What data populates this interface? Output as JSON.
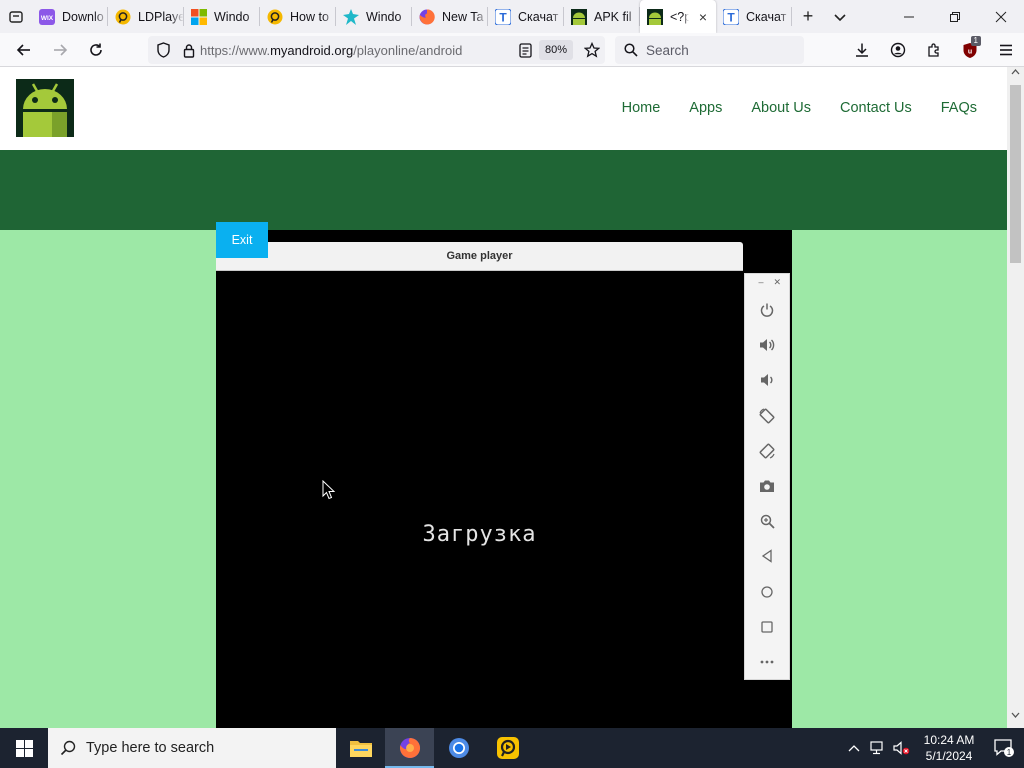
{
  "browser": {
    "tabs": [
      {
        "label": "Downlo",
        "favicon": "wix-icon",
        "color": "#8c58e8"
      },
      {
        "label": "LDPlaye",
        "favicon": "ldplayer-icon",
        "color": "#f5b800"
      },
      {
        "label": "Windo",
        "favicon": "windows-icon",
        "color": "#00a4ef"
      },
      {
        "label": "How to",
        "favicon": "ldplayer-icon",
        "color": "#f5b800"
      },
      {
        "label": "Windo",
        "favicon": "gear-icon",
        "color": "#1fb8c9"
      },
      {
        "label": "New Ta",
        "favicon": "firefox-icon",
        "color": "#ff7139"
      },
      {
        "label": "Скачат",
        "favicon": "t-icon",
        "color": "#2a6ad8"
      },
      {
        "label": "APK fil",
        "favicon": "android-icon",
        "color": "#1f6535"
      },
      {
        "label": "<?p",
        "favicon": "android-icon",
        "color": "#1f6535",
        "active": true
      },
      {
        "label": "Скачат",
        "favicon": "t-icon",
        "color": "#2a6ad8"
      }
    ],
    "url_prefix": "https://www.",
    "url_domain": "myandroid.org",
    "url_path": "/playonline/android",
    "zoom": "80%",
    "search_placeholder": "Search",
    "extension_badge": "1"
  },
  "site": {
    "nav": [
      "Home",
      "Apps",
      "About Us",
      "Contact Us",
      "FAQs"
    ],
    "exit_label": "Exit",
    "player_title": "Game player",
    "loading_text": "Загрузка",
    "side_controls": [
      "power-icon",
      "volume-up-icon",
      "volume-down-icon",
      "rotate-left-icon",
      "rotate-right-icon",
      "camera-icon",
      "zoom-icon",
      "back-icon",
      "home-icon",
      "recents-icon",
      "more-icon"
    ],
    "colors": {
      "band": "#1f6535",
      "background": "#9de8a6",
      "exit": "#0ab0f0",
      "link": "#1e6b35"
    }
  },
  "taskbar": {
    "search_placeholder": "Type here to search",
    "time": "10:24 AM",
    "date": "5/1/2024",
    "notification_count": "1"
  }
}
